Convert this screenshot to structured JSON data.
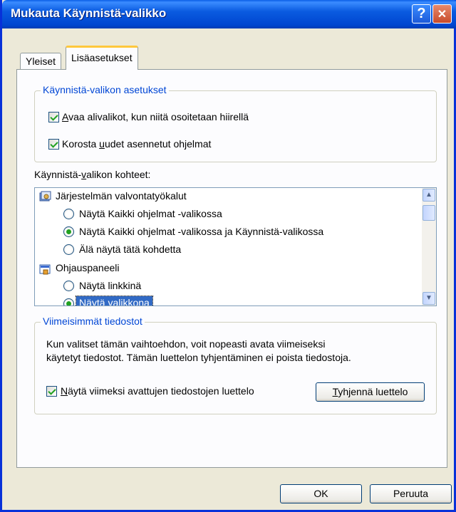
{
  "window": {
    "title": "Mukauta Käynnistä-valikko",
    "help_glyph": "?",
    "close_glyph": "✕"
  },
  "tabs": [
    {
      "label": "Yleiset",
      "active": false
    },
    {
      "label": "Lisäasetukset",
      "active": true
    }
  ],
  "start_menu_settings": {
    "legend": "Käynnistä-valikon asetukset",
    "options": [
      {
        "label_pre": "",
        "label_key": "A",
        "label_post": "vaa alivalikot, kun niitä osoitetaan hiirellä",
        "checked": true
      },
      {
        "label_pre": "Korosta ",
        "label_key": "u",
        "label_post": "udet asennetut ohjelmat",
        "checked": true
      }
    ]
  },
  "start_menu_items": {
    "label_pre": "Käynnistä-",
    "label_key": "v",
    "label_post": "alikon kohteet:",
    "entries": [
      {
        "type": "header",
        "icon": "admin-tools-icon",
        "text": "Järjestelmän valvontatyökalut"
      },
      {
        "type": "radio",
        "text": "Näytä Kaikki ohjelmat -valikossa",
        "selected": false
      },
      {
        "type": "radio",
        "text": "Näytä Kaikki ohjelmat -valikossa ja Käynnistä-valikossa",
        "selected": true
      },
      {
        "type": "radio",
        "text": "Älä näytä tätä kohdetta",
        "selected": false
      },
      {
        "type": "header",
        "icon": "control-panel-icon",
        "text": "Ohjauspaneeli"
      },
      {
        "type": "radio",
        "text": "Näytä linkkinä",
        "selected": false
      },
      {
        "type": "radio",
        "text": "Näytä valikkona",
        "selected": true
      }
    ]
  },
  "recent_documents": {
    "legend": "Viimeisimmät tiedostot",
    "description_line1": "Kun valitset tämän vaihtoehdon, voit nopeasti avata viimeiseksi",
    "description_line2": "käytetyt tiedostot. Tämän luettelon tyhjentäminen ei poista tiedostoja.",
    "checkbox_label_key": "N",
    "checkbox_label_post": "äytä viimeksi avattujen tiedostojen luettelo",
    "checked": true,
    "clear_button_key": "T",
    "clear_button_post": "yhjennä luettelo"
  },
  "buttons": {
    "ok": "OK",
    "cancel": "Peruuta"
  },
  "colors": {
    "title_bar": "#0a5be0",
    "group_legend": "#0046d5",
    "check_mark": "#21a121",
    "selection": "#316ac5"
  }
}
